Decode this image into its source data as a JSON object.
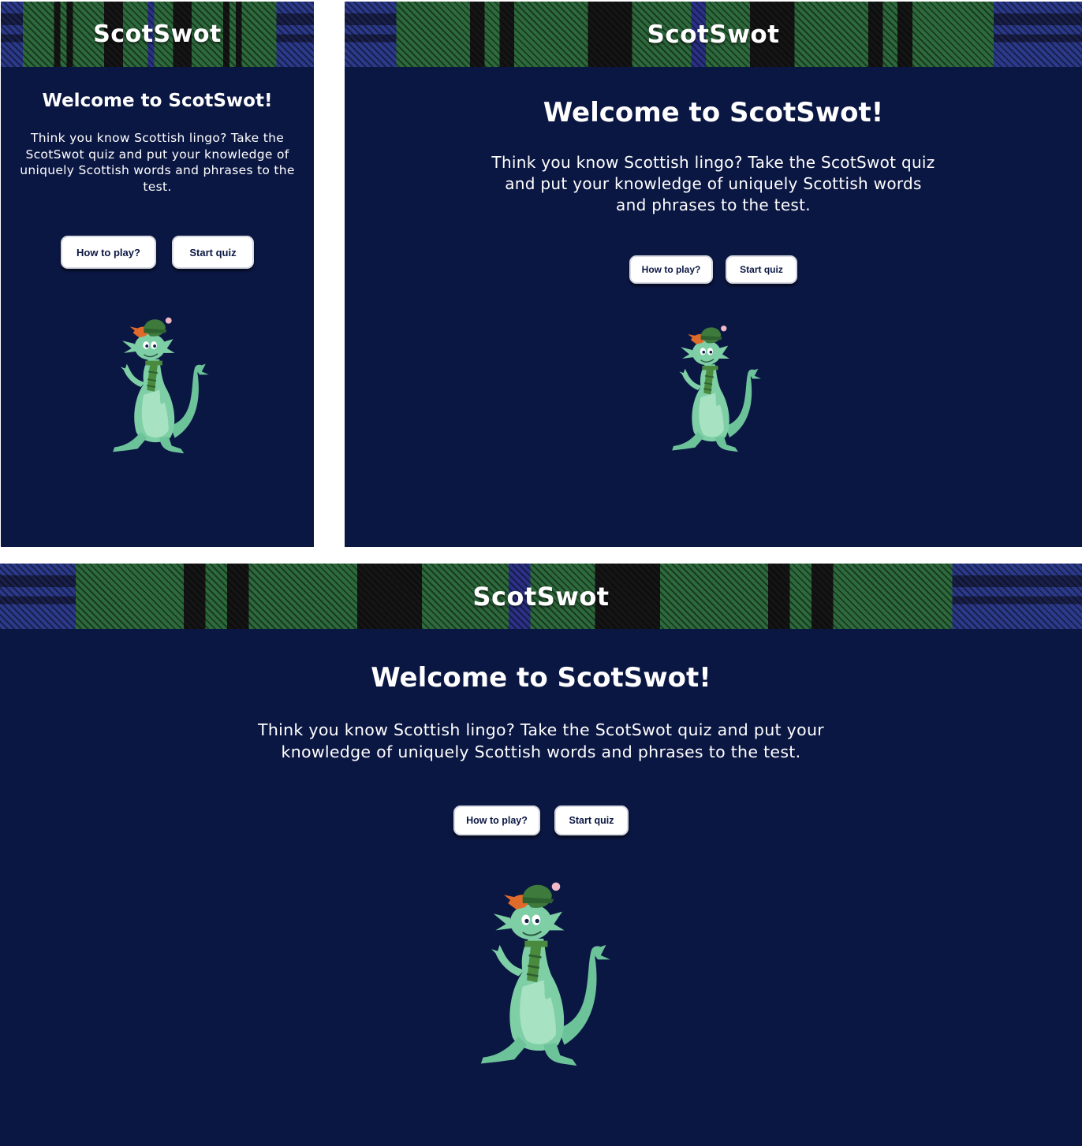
{
  "brand": "ScotSwot",
  "welcome": "Welcome to ScotSwot!",
  "intro": "Think you know Scottish lingo? Take the ScotSwot quiz and put your knowledge of uniquely Scottish words and phrases to the test.",
  "buttons": {
    "how_to_play": "How to play?",
    "start_quiz": "Start quiz"
  },
  "mascot_icon": "dragon-mascot-icon",
  "colors": {
    "background": "#0b1743",
    "button_bg": "#ffffff",
    "button_text": "#0b1743",
    "tartan_green": "#2d6a3c",
    "tartan_blue": "#2c3a8c",
    "mascot_green": "#7fcfa6"
  }
}
